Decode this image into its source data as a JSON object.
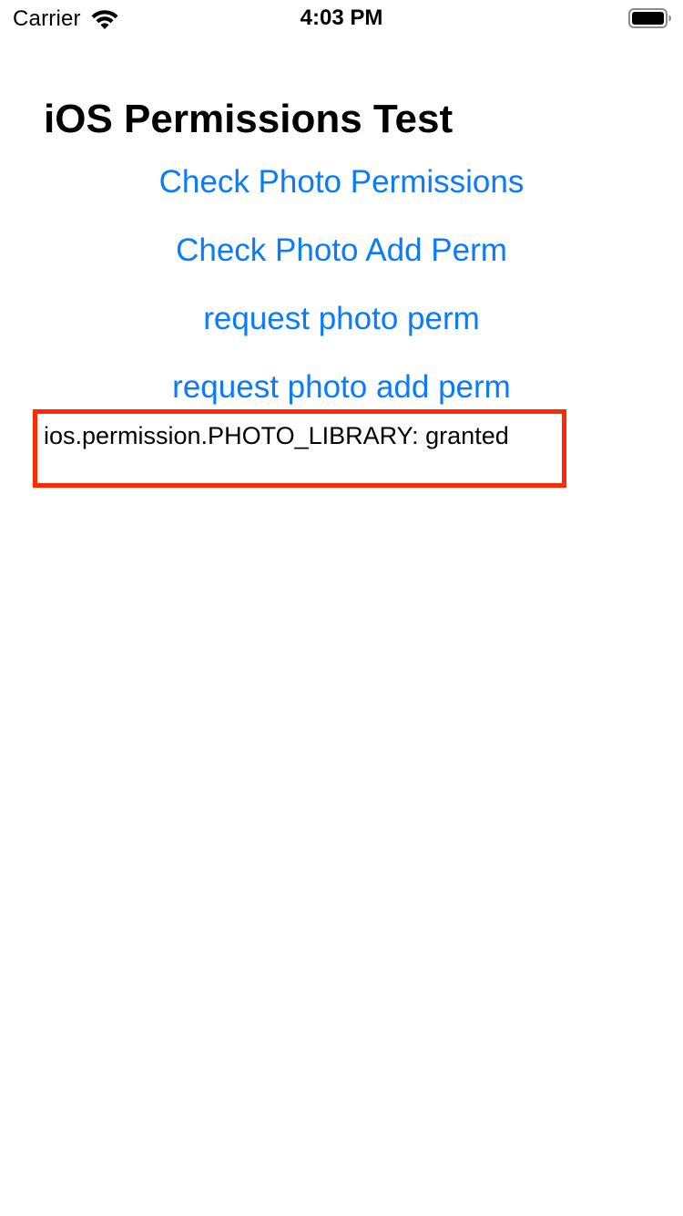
{
  "status_bar": {
    "carrier": "Carrier",
    "time": "4:03 PM",
    "wifi_icon": "wifi-icon",
    "battery_icon": "battery-full-icon"
  },
  "header": {
    "title": "iOS Permissions Test"
  },
  "buttons": [
    {
      "label": "Check Photo Permissions"
    },
    {
      "label": "Check Photo Add Perm"
    },
    {
      "label": "request photo perm"
    },
    {
      "label": "request photo add perm"
    }
  ],
  "result": {
    "text": "ios.permission.PHOTO_LIBRARY: granted",
    "highlight_color": "#ff2a00"
  },
  "colors": {
    "link": "#0a7aff",
    "text": "#000000",
    "background": "#ffffff"
  }
}
